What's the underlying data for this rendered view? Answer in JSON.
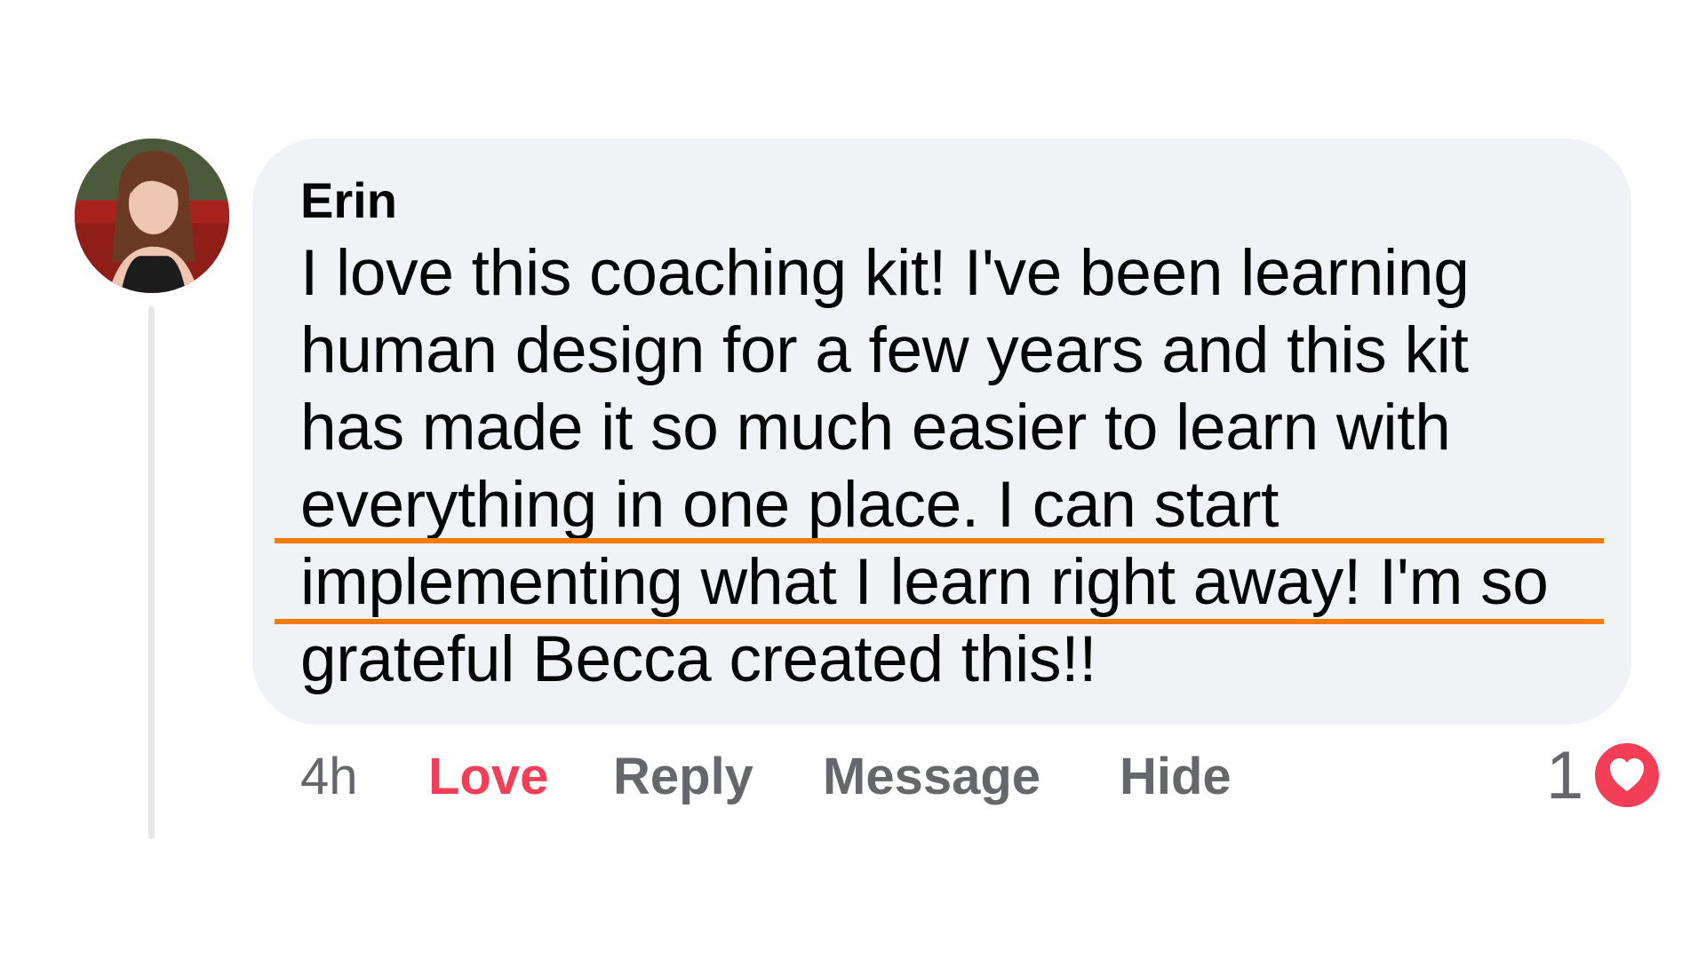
{
  "comment": {
    "author": "Erin",
    "body_lines": [
      "I love this coaching kit! I've been learning",
      "human design for a few years and this kit",
      "has made it so much easier to learn with",
      "everything in one place. I can start",
      "implementing what I learn right away! I'm so",
      "grateful Becca created this!!"
    ],
    "highlighted_line_index": 4
  },
  "actions": {
    "time": "4h",
    "love": "Love",
    "reply": "Reply",
    "message": "Message",
    "hide": "Hide"
  },
  "reactions": {
    "count": "1",
    "type_icon": "heart-icon"
  },
  "colors": {
    "bubble_bg": "#f0f2f5",
    "text": "#050505",
    "muted": "#65676b",
    "love": "#f33e58",
    "highlight": "#f57c00"
  }
}
